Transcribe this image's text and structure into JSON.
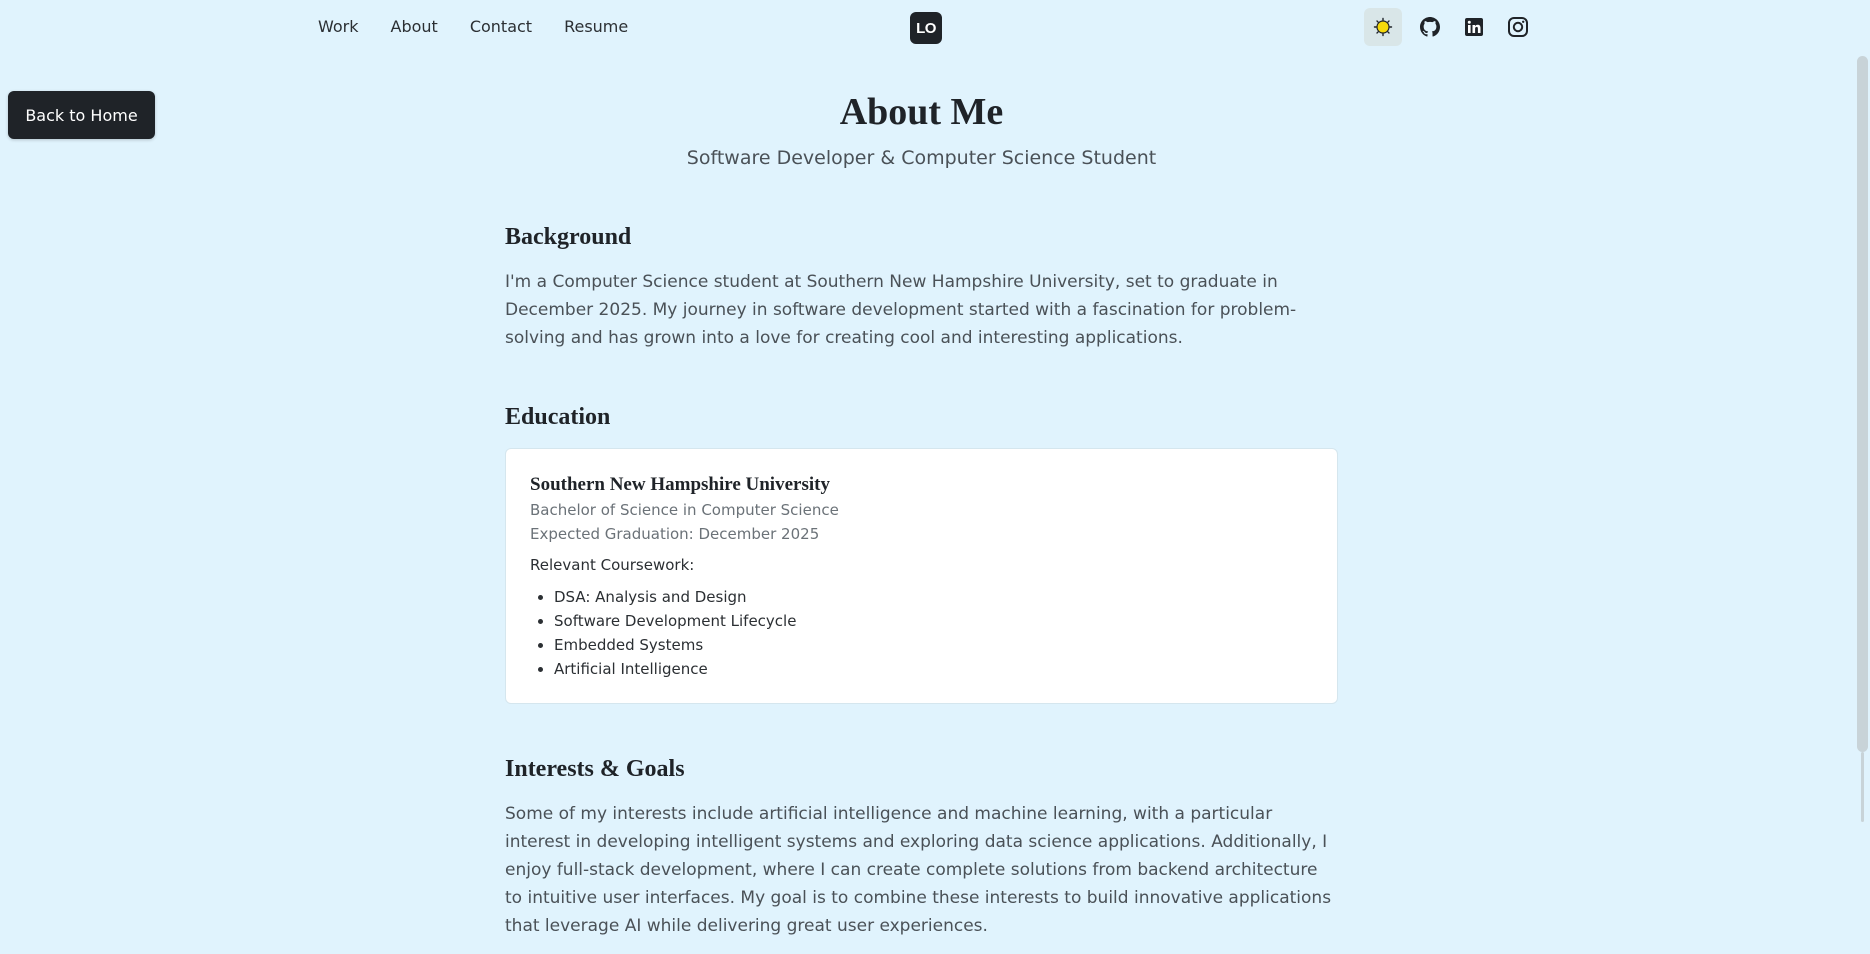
{
  "nav": {
    "links": [
      "Work",
      "About",
      "Contact",
      "Resume"
    ],
    "logo": "LO",
    "icons": [
      "sun-icon",
      "github-icon",
      "linkedin-icon",
      "instagram-icon"
    ]
  },
  "back_button": "Back to Home",
  "header": {
    "title": "About Me",
    "subtitle": "Software Developer & Computer Science Student"
  },
  "background": {
    "title": "Background",
    "text": "I'm a Computer Science student at Southern New Hampshire University, set to graduate in December 2025. My journey in software development started with a fascination for problem-solving and has grown into a love for creating cool and interesting applications."
  },
  "education": {
    "title": "Education",
    "university": "Southern New Hampshire University",
    "degree": "Bachelor of Science in Computer Science",
    "graduation": "Expected Graduation: December 2025",
    "coursework_label": "Relevant Coursework:",
    "coursework": [
      "DSA: Analysis and Design",
      "Software Development Lifecycle",
      "Embedded Systems",
      "Artificial Intelligence"
    ]
  },
  "interests": {
    "title": "Interests & Goals",
    "text": "Some of my interests include artificial intelligence and machine learning, with a particular interest in developing intelligent systems and exploring data science applications. Additionally, I enjoy full-stack development, where I can create complete solutions from backend architecture to intuitive user interfaces. My goal is to combine these interests to build innovative applications that leverage AI while delivering great user experiences."
  },
  "colors": {
    "background": "#e0f3fd",
    "dark": "#1f2328",
    "sun": "#f5d90a"
  }
}
